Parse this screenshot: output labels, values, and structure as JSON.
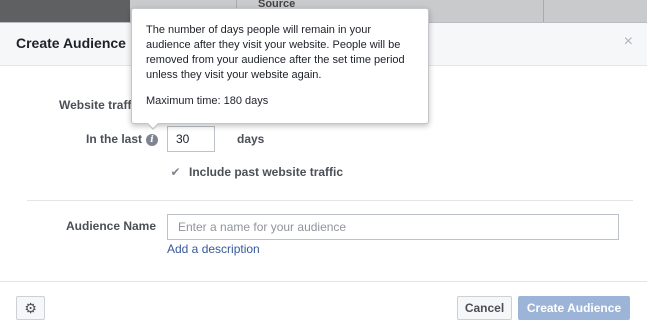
{
  "background": {
    "column_label": "Source"
  },
  "dialog": {
    "title": "Create Audience",
    "close_icon": "close-icon",
    "close_symbol": "×"
  },
  "form": {
    "website_traffic_label": "Website traffic",
    "in_the_last_label": "In the last",
    "info_icon": "info-icon",
    "info_symbol": "i",
    "days_value": "30",
    "days_unit": "days",
    "include_past_checked": true,
    "include_past_check_symbol": "✔",
    "include_past_label": "Include past website traffic",
    "audience_name_label": "Audience Name",
    "audience_name_value": "",
    "audience_name_placeholder": "Enter a name for your audience",
    "add_description_link": "Add a description"
  },
  "tooltip": {
    "description": "The number of days people will remain in your audience after they visit your website. People will be removed from your audience after the set time period unless they visit your website again.",
    "maximum": "Maximum time: 180 days"
  },
  "footer": {
    "settings_icon": "gear-icon",
    "settings_symbol": "⚙",
    "cancel_label": "Cancel",
    "create_label": "Create Audience"
  },
  "colors": {
    "primary_disabled": "#9cb4d8",
    "link": "#365899",
    "overlay": "#5f6062"
  }
}
